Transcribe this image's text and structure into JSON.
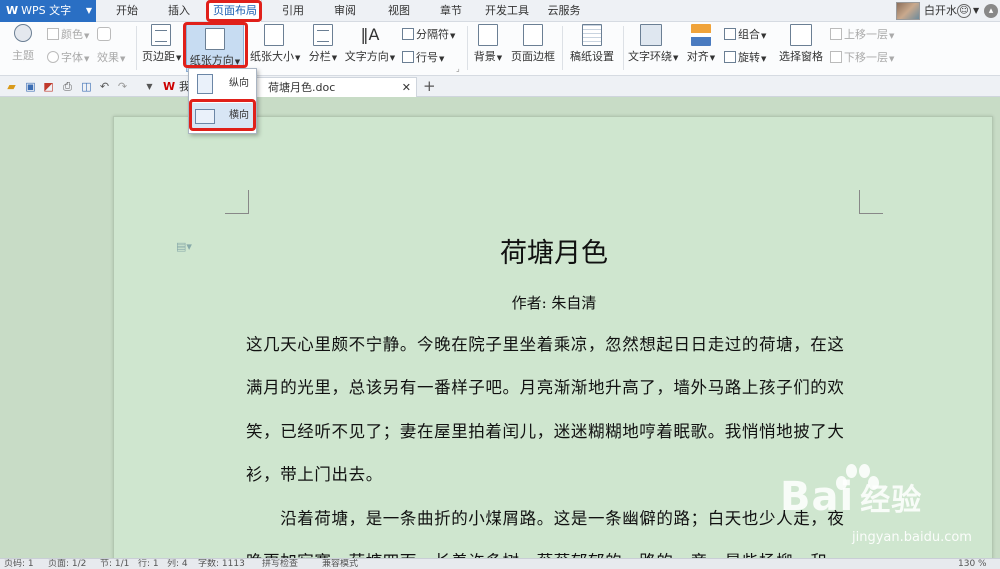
{
  "app": {
    "name": "WPS 文字"
  },
  "menu_tabs": [
    "开始",
    "插入",
    "页面布局",
    "引用",
    "审阅",
    "视图",
    "章节",
    "开发工具",
    "云服务"
  ],
  "user": {
    "name": "白开水"
  },
  "ribbon": {
    "theme": {
      "color": "颜色",
      "theme": "主题",
      "font": "字体",
      "effect": "效果"
    },
    "margins": "页边距",
    "orientation": "纸张方向",
    "paper_size": "纸张大小",
    "columns": "分栏",
    "text_direction": "文字方向",
    "breaks": "分隔符",
    "line_numbers": "行号",
    "background": "背景",
    "page_border": "页面边框",
    "manuscript": "稿纸设置",
    "text_wrap": "文字环绕",
    "align": "对齐",
    "group": "组合",
    "rotate": "旋转",
    "selection_pane": "选择窗格",
    "bring_forward": "上移一层",
    "send_backward": "下移一层"
  },
  "orientation_menu": {
    "portrait": "纵向",
    "landscape": "横向"
  },
  "tabs": {
    "wps_label": "我",
    "doc_name": "荷塘月色.doc"
  },
  "document": {
    "title": "荷塘月色",
    "author": "作者: 朱自清",
    "lines": [
      "这几天心里颇不宁静。今晚在院子里坐着乘凉，忽然想起日日走过的荷塘，在这",
      "满月的光里，总该另有一番样子吧。月亮渐渐地升高了，墙外马路上孩子们的欢",
      "笑，已经听不见了；妻在屋里拍着闰儿，迷迷糊糊地哼着眠歌。我悄悄地披了大",
      "衫，带上门出去。",
      "　　沿着荷塘，是一条曲折的小煤屑路。这是一条幽僻的路；白天也少人走，夜",
      "晚更加寂寞。荷塘四面，长着许多树，蓊蓊郁郁的。路的一旁，是些杨柳，和一"
    ]
  },
  "status": {
    "page": "页码: 1",
    "pages": "页面: 1/2",
    "section": "节: 1/1",
    "row": "行: 1",
    "col": "列: 4",
    "words": "字数: 1113",
    "spell": "拼写检查",
    "mode": "兼容模式",
    "zoom": "130 %"
  },
  "watermark": {
    "brand": "Bai",
    "brand_cn": "经验",
    "url": "jingyan.baidu.com"
  },
  "colors": {
    "accent": "#2a6fc4",
    "highlight": "#e0201a",
    "page_bg": "#cfe6cf"
  }
}
